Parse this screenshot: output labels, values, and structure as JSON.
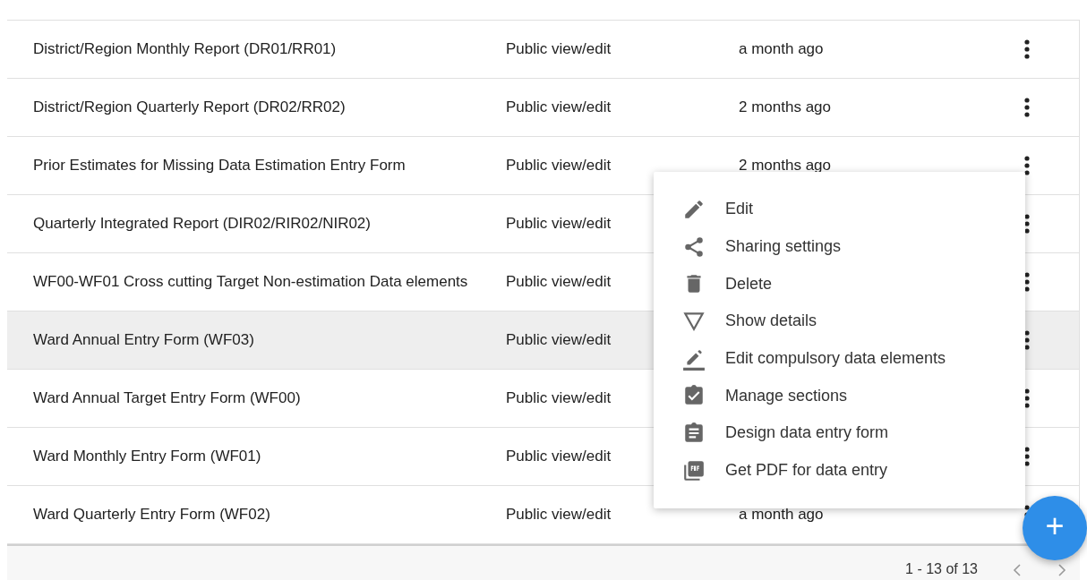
{
  "rows": [
    {
      "name": "District/Region Monthly Report (DR01/RR01)",
      "sharing": "Public view/edit",
      "updated": "a month ago",
      "highlighted": false
    },
    {
      "name": "District/Region Quarterly Report (DR02/RR02)",
      "sharing": "Public view/edit",
      "updated": "2 months ago",
      "highlighted": false
    },
    {
      "name": "Prior Estimates for Missing Data Estimation Entry Form",
      "sharing": "Public view/edit",
      "updated": "2 months ago",
      "highlighted": false
    },
    {
      "name": "Quarterly Integrated Report (DIR02/RIR02/NIR02)",
      "sharing": "Public view/edit",
      "highlighted": false
    },
    {
      "name": "WF00-WF01 Cross cutting Target Non-estimation Data elements",
      "sharing": "Public view/edit",
      "highlighted": false
    },
    {
      "name": "Ward Annual Entry Form (WF03)",
      "sharing": "Public view/edit",
      "highlighted": true
    },
    {
      "name": "Ward Annual Target Entry Form (WF00)",
      "sharing": "Public view/edit",
      "highlighted": false
    },
    {
      "name": "Ward Monthly Entry Form (WF01)",
      "sharing": "Public view/edit",
      "highlighted": false
    },
    {
      "name": "Ward Quarterly Entry Form (WF02)",
      "sharing": "Public view/edit",
      "updated": "a month ago",
      "highlighted": false
    }
  ],
  "context_menu": {
    "items": [
      {
        "label": "Edit",
        "kind": "pencil"
      },
      {
        "label": "Sharing settings",
        "kind": "share"
      },
      {
        "label": "Delete",
        "kind": "trash"
      },
      {
        "label": "Show details",
        "kind": "triangle"
      },
      {
        "label": "Edit compulsory data elements",
        "kind": "pencil-line"
      },
      {
        "label": "Manage sections",
        "kind": "clipboard-check"
      },
      {
        "label": "Design data entry form",
        "kind": "clipboard-text"
      },
      {
        "label": "Get PDF for data entry",
        "kind": "pdf"
      }
    ]
  },
  "pagination": {
    "range": "1 - 13 of 13",
    "previous_disabled": true,
    "next_disabled": true
  },
  "fab": {
    "label": "+"
  }
}
